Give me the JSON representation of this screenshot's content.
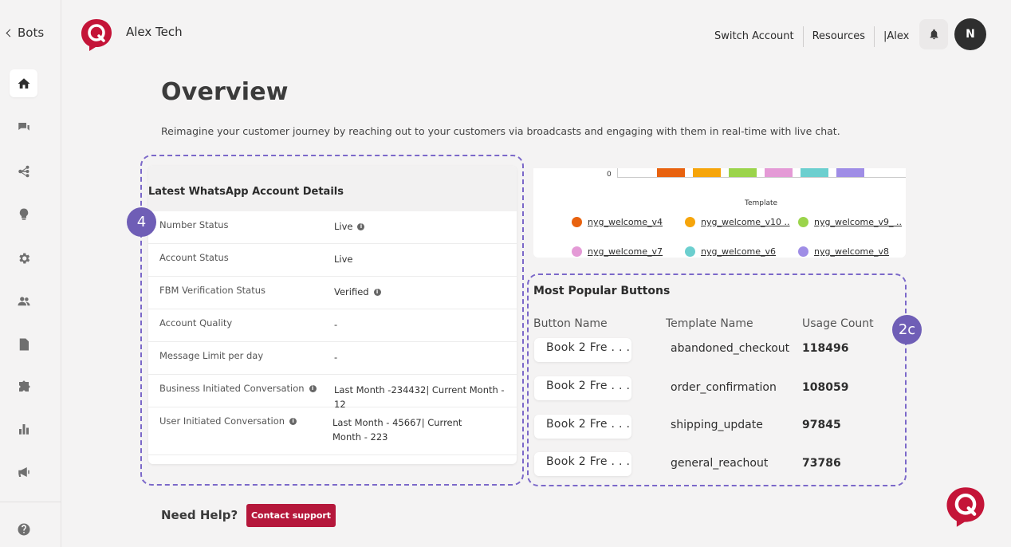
{
  "sidebar": {
    "back_label": "Bots",
    "icons": [
      "home-icon",
      "chat-icon",
      "flow-icon",
      "bulb-icon",
      "gear-icon",
      "users-icon",
      "document-icon",
      "puzzle-icon",
      "bar-chart-icon",
      "megaphone-icon",
      "help-icon"
    ]
  },
  "header": {
    "company": "Alex Tech",
    "links": [
      "Switch Account",
      "Resources",
      "|Alex"
    ],
    "avatar_initial": "N"
  },
  "page": {
    "title": "Overview",
    "subtitle": "Reimagine your customer journey by reaching out to your customers via broadcasts and engaging with them in real-time with live chat."
  },
  "badges": {
    "account": "4",
    "popular": "2c"
  },
  "account_card": {
    "title": "Latest WhatsApp Account Details",
    "rows": [
      {
        "label": "Number Status",
        "value": "Live",
        "value_info": true
      },
      {
        "label": "Account Status",
        "value": "Live"
      },
      {
        "label": "FBM Verification Status",
        "value": "Verified",
        "value_info": true
      },
      {
        "label": "Account Quality",
        "value": "-"
      },
      {
        "label": "Message Limit per day",
        "value": "-"
      },
      {
        "label": "Business Initiated Conversation",
        "label_info": true,
        "value": "Last Month -234432| Current Month - 12"
      },
      {
        "label": "User Initiated Conversation",
        "label_info": true,
        "value": "Last Month - 45667| Current Month - 223"
      }
    ]
  },
  "chart_data": {
    "type": "bar",
    "xlabel": "Template",
    "y_tick_visible": "0",
    "series": [
      {
        "name": "nyg_welcome_v4",
        "color": "#e8620f"
      },
      {
        "name": "nyg_welcome_v10 ..",
        "color": "#f6a50b"
      },
      {
        "name": "nyg_welcome_v9_ ..",
        "color": "#9bd44b"
      },
      {
        "name": "nyg_welcome_v7",
        "color": "#e49ad6"
      },
      {
        "name": "nyg_welcome_v6",
        "color": "#6ccfcf"
      },
      {
        "name": "nyg_welcome_v8",
        "color": "#9f8de6"
      }
    ]
  },
  "popular": {
    "title": "Most Popular Buttons",
    "headers": [
      "Button Name",
      "Template Name",
      "Usage Count"
    ],
    "rows": [
      {
        "button": "Book 2 Fre . . .",
        "template": "abandoned_checkout",
        "count": "118496"
      },
      {
        "button": "Book 2 Fre . . .",
        "template": "order_confirmation",
        "count": "108059"
      },
      {
        "button": "Book 2 Fre . . .",
        "template": "shipping_update",
        "count": "97845"
      },
      {
        "button": "Book 2 Fre . . .",
        "template": "general_reachout",
        "count": "73786"
      }
    ]
  },
  "footer": {
    "help_text": "Need Help?",
    "contact_label": "Contact support"
  },
  "colors": {
    "brand": "#b5173b",
    "badge": "#6f5eb6",
    "dashed": "#7b68c9"
  }
}
